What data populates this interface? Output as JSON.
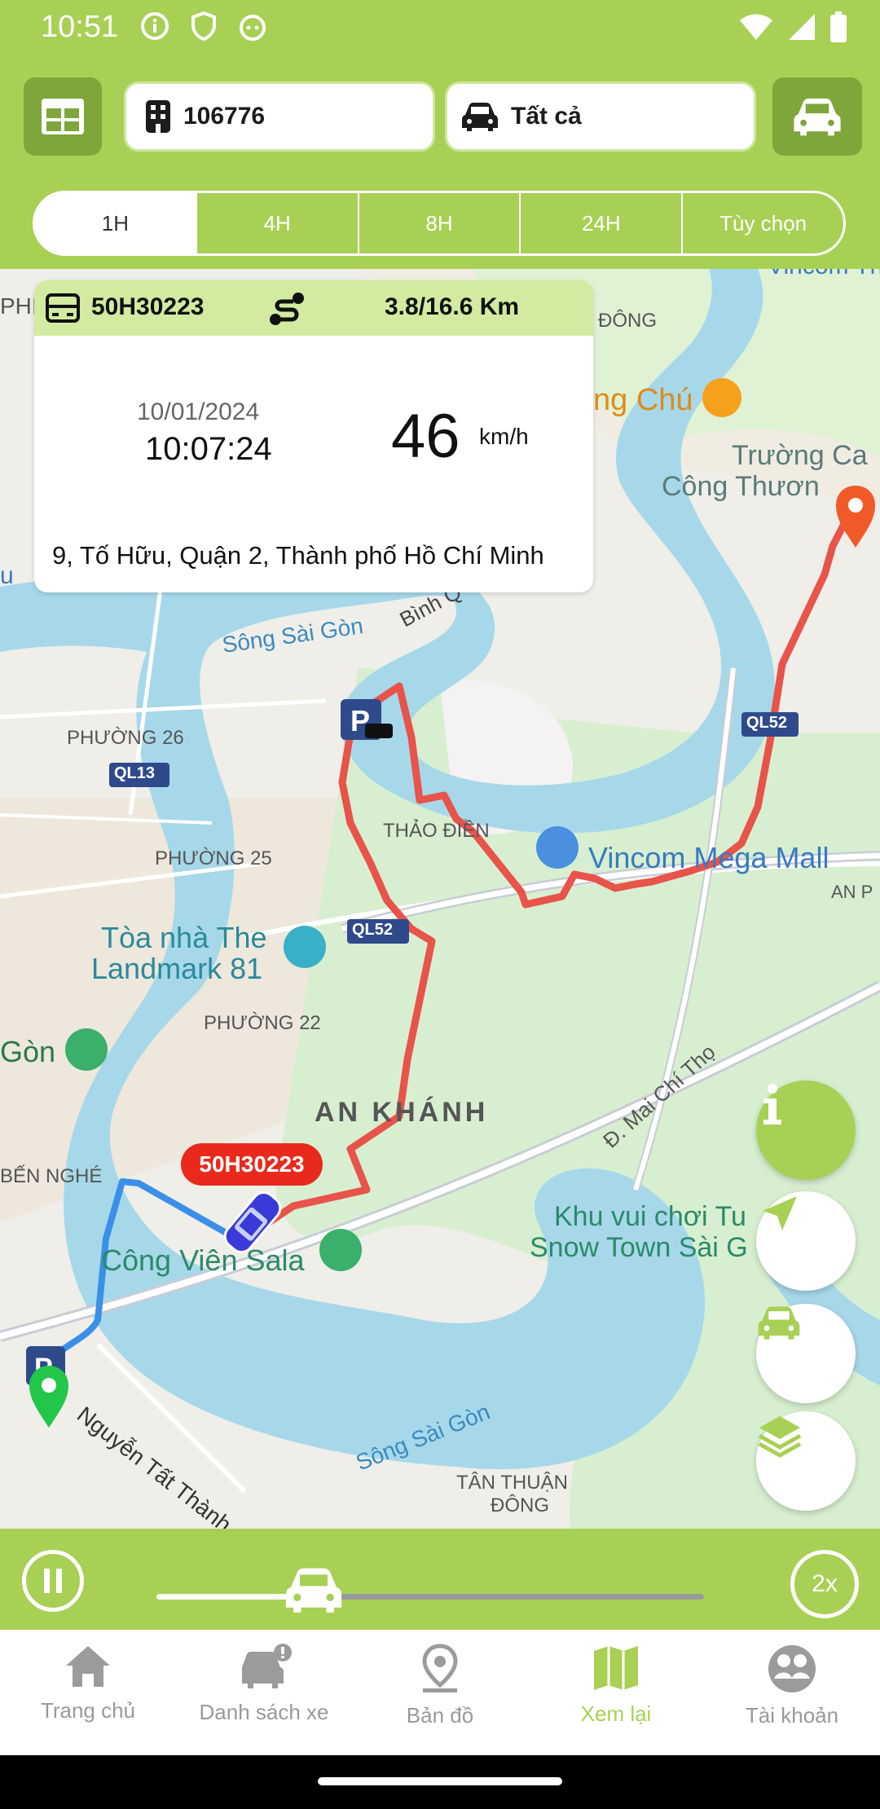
{
  "status": {
    "time": "10:51"
  },
  "toolbar": {
    "vehicle_code": "106776",
    "vehicle_filter": "Tất cả"
  },
  "time_ranges": [
    "1H",
    "4H",
    "8H",
    "24H",
    "Tùy chọn"
  ],
  "info": {
    "plate": "50H30223",
    "distance": "3.8/16.6 Km",
    "date": "10/01/2024",
    "time": "10:07:24",
    "speed": "46",
    "speed_unit": "km/h",
    "address": "9, Tố Hữu, Quận 2, Thành phố Hồ Chí Minh"
  },
  "map": {
    "vehicle_label": "50H30223",
    "labels": {
      "dong_top": "ĐÔNG",
      "ng_chu": "ng Chú",
      "truong_cao": "Trường Ca",
      "cong_thuong": "Công Thươn",
      "song_sai_gon_1": "Sông Sài Gòn",
      "binh": "Bình Q",
      "phuong26": "PHƯỜNG 26",
      "ql13": "QL13",
      "ql52_top": "QL52",
      "thao_dien": "THẢO ĐIỀN",
      "vincom": "Vincom Mega Mall",
      "an_p": "AN P",
      "phuong25": "PHƯỜNG 25",
      "landmark1": "Tòa nhà The",
      "landmark2": "Landmark 81",
      "ql52_mid": "QL52",
      "phuong22": "PHƯỜNG 22",
      "gon": "Gòn",
      "an_khanh": "AN KHÁNH",
      "mai_chi_tho": "Đ. Mai Chí Thọ",
      "ben_nghe": "BẾN NGHÉ",
      "khu_vui_choi1": "Khu vui chơi Tu",
      "khu_vui_choi2": "Snow Town Sài G",
      "cong_vien": "Công Viên Sala",
      "nguyen_tat_thanh": "Nguyễn Tất Thành",
      "song_sai_gon_2": "Sông Sài Gòn",
      "tan_thuan": "TÂN THUẬN",
      "dong_bottom": "ĐÔNG",
      "vincom_thu": "Vincom Thủ L",
      "phi": "PHI",
      "u_left": "u"
    }
  },
  "playback": {
    "speed": "2x",
    "progress": 0.28
  },
  "nav": [
    {
      "label": "Trang chủ"
    },
    {
      "label": "Danh sách xe"
    },
    {
      "label": "Bản đồ"
    },
    {
      "label": "Xem lại"
    },
    {
      "label": "Tài khoản"
    }
  ],
  "colors": {
    "brand": "#a8d054",
    "route": "#e8534a",
    "route_alt": "#3b8fe8"
  }
}
